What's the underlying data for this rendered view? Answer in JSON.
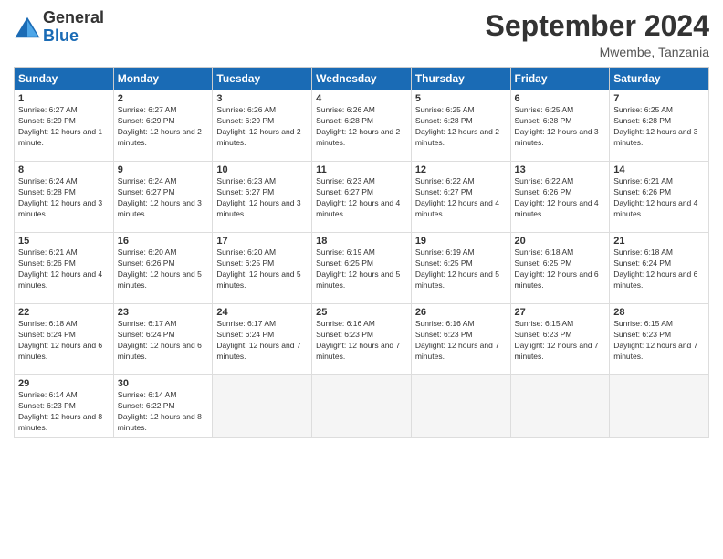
{
  "header": {
    "logo_general": "General",
    "logo_blue": "Blue",
    "month": "September 2024",
    "location": "Mwembe, Tanzania"
  },
  "days_of_week": [
    "Sunday",
    "Monday",
    "Tuesday",
    "Wednesday",
    "Thursday",
    "Friday",
    "Saturday"
  ],
  "weeks": [
    [
      {
        "day": "1",
        "sunrise": "6:27 AM",
        "sunset": "6:29 PM",
        "daylight": "12 hours and 1 minute."
      },
      {
        "day": "2",
        "sunrise": "6:27 AM",
        "sunset": "6:29 PM",
        "daylight": "12 hours and 2 minutes."
      },
      {
        "day": "3",
        "sunrise": "6:26 AM",
        "sunset": "6:29 PM",
        "daylight": "12 hours and 2 minutes."
      },
      {
        "day": "4",
        "sunrise": "6:26 AM",
        "sunset": "6:28 PM",
        "daylight": "12 hours and 2 minutes."
      },
      {
        "day": "5",
        "sunrise": "6:25 AM",
        "sunset": "6:28 PM",
        "daylight": "12 hours and 2 minutes."
      },
      {
        "day": "6",
        "sunrise": "6:25 AM",
        "sunset": "6:28 PM",
        "daylight": "12 hours and 3 minutes."
      },
      {
        "day": "7",
        "sunrise": "6:25 AM",
        "sunset": "6:28 PM",
        "daylight": "12 hours and 3 minutes."
      }
    ],
    [
      {
        "day": "8",
        "sunrise": "6:24 AM",
        "sunset": "6:28 PM",
        "daylight": "12 hours and 3 minutes."
      },
      {
        "day": "9",
        "sunrise": "6:24 AM",
        "sunset": "6:27 PM",
        "daylight": "12 hours and 3 minutes."
      },
      {
        "day": "10",
        "sunrise": "6:23 AM",
        "sunset": "6:27 PM",
        "daylight": "12 hours and 3 minutes."
      },
      {
        "day": "11",
        "sunrise": "6:23 AM",
        "sunset": "6:27 PM",
        "daylight": "12 hours and 4 minutes."
      },
      {
        "day": "12",
        "sunrise": "6:22 AM",
        "sunset": "6:27 PM",
        "daylight": "12 hours and 4 minutes."
      },
      {
        "day": "13",
        "sunrise": "6:22 AM",
        "sunset": "6:26 PM",
        "daylight": "12 hours and 4 minutes."
      },
      {
        "day": "14",
        "sunrise": "6:21 AM",
        "sunset": "6:26 PM",
        "daylight": "12 hours and 4 minutes."
      }
    ],
    [
      {
        "day": "15",
        "sunrise": "6:21 AM",
        "sunset": "6:26 PM",
        "daylight": "12 hours and 4 minutes."
      },
      {
        "day": "16",
        "sunrise": "6:20 AM",
        "sunset": "6:26 PM",
        "daylight": "12 hours and 5 minutes."
      },
      {
        "day": "17",
        "sunrise": "6:20 AM",
        "sunset": "6:25 PM",
        "daylight": "12 hours and 5 minutes."
      },
      {
        "day": "18",
        "sunrise": "6:19 AM",
        "sunset": "6:25 PM",
        "daylight": "12 hours and 5 minutes."
      },
      {
        "day": "19",
        "sunrise": "6:19 AM",
        "sunset": "6:25 PM",
        "daylight": "12 hours and 5 minutes."
      },
      {
        "day": "20",
        "sunrise": "6:18 AM",
        "sunset": "6:25 PM",
        "daylight": "12 hours and 6 minutes."
      },
      {
        "day": "21",
        "sunrise": "6:18 AM",
        "sunset": "6:24 PM",
        "daylight": "12 hours and 6 minutes."
      }
    ],
    [
      {
        "day": "22",
        "sunrise": "6:18 AM",
        "sunset": "6:24 PM",
        "daylight": "12 hours and 6 minutes."
      },
      {
        "day": "23",
        "sunrise": "6:17 AM",
        "sunset": "6:24 PM",
        "daylight": "12 hours and 6 minutes."
      },
      {
        "day": "24",
        "sunrise": "6:17 AM",
        "sunset": "6:24 PM",
        "daylight": "12 hours and 7 minutes."
      },
      {
        "day": "25",
        "sunrise": "6:16 AM",
        "sunset": "6:23 PM",
        "daylight": "12 hours and 7 minutes."
      },
      {
        "day": "26",
        "sunrise": "6:16 AM",
        "sunset": "6:23 PM",
        "daylight": "12 hours and 7 minutes."
      },
      {
        "day": "27",
        "sunrise": "6:15 AM",
        "sunset": "6:23 PM",
        "daylight": "12 hours and 7 minutes."
      },
      {
        "day": "28",
        "sunrise": "6:15 AM",
        "sunset": "6:23 PM",
        "daylight": "12 hours and 7 minutes."
      }
    ],
    [
      {
        "day": "29",
        "sunrise": "6:14 AM",
        "sunset": "6:23 PM",
        "daylight": "12 hours and 8 minutes."
      },
      {
        "day": "30",
        "sunrise": "6:14 AM",
        "sunset": "6:22 PM",
        "daylight": "12 hours and 8 minutes."
      },
      null,
      null,
      null,
      null,
      null
    ]
  ]
}
